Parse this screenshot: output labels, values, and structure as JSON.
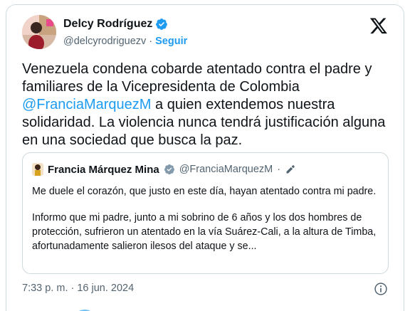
{
  "author": {
    "name": "Delcy Rodríguez",
    "handle": "@delcyrodriguezv",
    "separator": "·",
    "follow_label": "Seguir"
  },
  "tweet": {
    "text_part1": "Venezuela condena cobarde atentado contra el padre y familiares de la Vicepresidenta de Colombia ",
    "mention": "@FranciaMarquezM",
    "text_part2": " a quien extendemos nuestra solidaridad. La violencia nunca tendrá justificación alguna en una sociedad que busca la paz.",
    "timestamp": "7:33 p. m. · 16 jun. 2024"
  },
  "quote": {
    "name": "Francia Márquez Mina",
    "handle": "@FranciaMarquezM",
    "separator": "·",
    "paragraph1": "Me duele el corazón, que justo en este día, hayan atentado contra mi padre.",
    "paragraph2": "Informo que mi padre, junto a mi sobrino de 6 años y los dos hombres de protección, sufrieron un atentado en la vía Suárez-Cali, a la altura de Timba, afortunadamente salieron ilesos del ataque y se..."
  },
  "icons": {
    "verified": "verified-badge-icon",
    "platform": "x-logo-icon",
    "info": "info-icon",
    "edit": "pencil-icon"
  },
  "colors": {
    "accent": "#1d9bf0",
    "secondary_text": "#536471",
    "border": "#cfd9de"
  }
}
